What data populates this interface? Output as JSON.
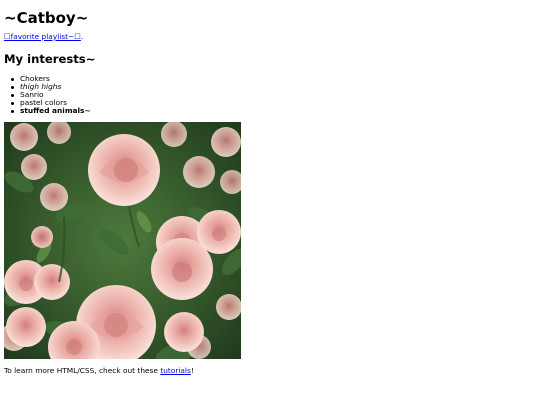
{
  "title": "~Catboy~",
  "playlist": {
    "prefix_glyph": "☐",
    "label": "favorite playlist~",
    "suffix_glyph": "☐",
    "trailing": "."
  },
  "interests_heading": "My interests~",
  "interests": [
    {
      "text": "Chokers",
      "style": "normal"
    },
    {
      "text": "thigh highs",
      "style": "italic"
    },
    {
      "text": "Sanrio",
      "style": "normal"
    },
    {
      "text": "pastel colors",
      "style": "normal"
    },
    {
      "text": "stuffed animals~",
      "style": "bold"
    }
  ],
  "footer": {
    "before": "To learn more HTML/CSS, check out these ",
    "link_text": "tutorials",
    "after": "!"
  },
  "colors": {
    "link": "#0000ee",
    "rose_light": "#f4c9c2",
    "rose_mid": "#e8a49c",
    "rose_deep": "#cf7f7c",
    "leaf": "#3f6b35",
    "leaf_dark": "#223d1f"
  }
}
